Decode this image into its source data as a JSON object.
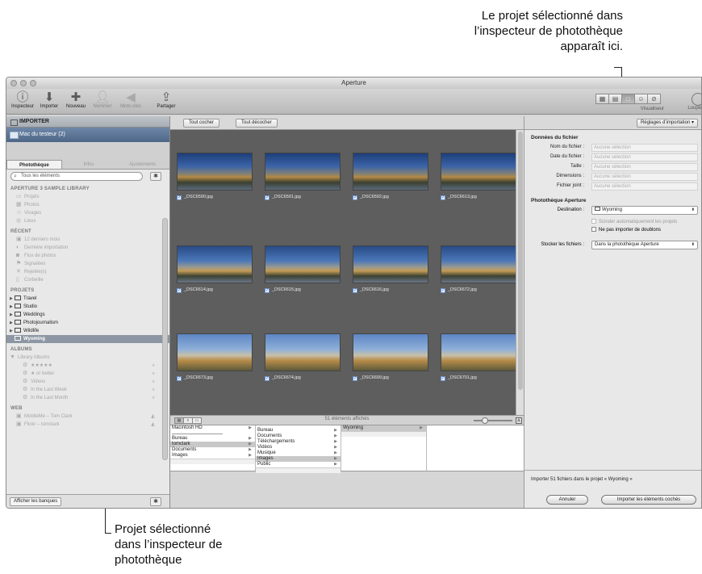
{
  "callouts": {
    "top": [
      "Le projet sélectionné dans",
      "l’inspecteur de photothèque",
      "apparaît ici."
    ],
    "bottom": [
      "Projet sélectionné",
      "dans l’inspecteur de",
      "photothèque"
    ]
  },
  "window": {
    "title": "Aperture"
  },
  "toolbar": {
    "inspector": "Inspecteur",
    "import": "Importer",
    "new": "Nouveau",
    "name": "Nommer",
    "keywords": "Mots-clés",
    "share": "Partager",
    "viewer": "Visualiseur",
    "loupe": "Loupe"
  },
  "import_panel": {
    "header": "IMPORTER",
    "device": "Mac du testeur (2)"
  },
  "library": {
    "tabs": [
      "Photothèque",
      "Infos",
      "Ajustements"
    ],
    "search_value": "Tous les éléments",
    "sections": {
      "sample": "APERTURE 3 SAMPLE LIBRARY",
      "recent": "RÉCENT",
      "projects": "PROJETS",
      "albums": "ALBUMS",
      "web": "WEB"
    },
    "sample_items": [
      "Projets",
      "Photos",
      "Visages",
      "Lieux"
    ],
    "recent_items": [
      "12 derniers mois",
      "Dernière importation",
      "Flux de photos",
      "Signalées",
      "Rejetée(s)",
      "Corbeille"
    ],
    "project_items": [
      "Travel",
      "Studio",
      "Weddings",
      "Photojournalism",
      "Wildlife",
      "Wyoming"
    ],
    "album_items": [
      "Library Albums",
      "★★★★★",
      "★ or better",
      "Videos",
      "In the Last Week",
      "In the Last Month"
    ],
    "web_items": [
      "MobileMe – Tom Clark",
      "Flickr – tomclark"
    ],
    "show_vaults": "Afficher les banques"
  },
  "browser": {
    "check_all": "Tout cocher",
    "uncheck_all": "Tout décocher",
    "thumbnails": [
      "_DSC6590.jpg",
      "_DSC6591.jpg",
      "_DSC6592.jpg",
      "_DSC6613.jpg",
      "_DSC6614.jpg",
      "_DSC6615.jpg",
      "_DSC6616.jpg",
      "_DSC6672.jpg",
      "_DSC6673.jpg",
      "_DSC6674.jpg",
      "_DSC6699.jpg",
      "_DSC6701.jpg"
    ],
    "count": "51 éléments affichés",
    "columns": [
      [
        "Macintosh HD",
        "Bureau",
        "tomclark",
        "Documents",
        "Images"
      ],
      [
        "Bureau",
        "Documents",
        "Téléchargements",
        "Vidéos",
        "Musique",
        "Images",
        "Public"
      ],
      [
        "Wyoming"
      ]
    ]
  },
  "inspector": {
    "settings_button": "Réglages d’importation",
    "file_data": "Données du fichier",
    "fields": [
      {
        "label": "Nom du fichier :",
        "value": "Aucune sélection"
      },
      {
        "label": "Date du fichier :",
        "value": "Aucune sélection"
      },
      {
        "label": "Taille :",
        "value": "Aucune sélection"
      },
      {
        "label": "Dimensions :",
        "value": "Aucune sélection"
      },
      {
        "label": "Fichier joint :",
        "value": "Aucune sélection"
      }
    ],
    "library_section": "Photothèque Aperture",
    "destination_label": "Destination :",
    "destination_value": "Wyoming",
    "split_projects": "Scinder automatiquement les projets",
    "no_duplicates": "Ne pas importer de doublons",
    "store_label": "Stocker les fichiers :",
    "store_value": "Dans la photothèque Aperture",
    "import_message": "Importer 51 fichiers dans le projet « Wyoming »",
    "cancel": "Annuler",
    "import_checked": "Importer les éléments cochés"
  }
}
